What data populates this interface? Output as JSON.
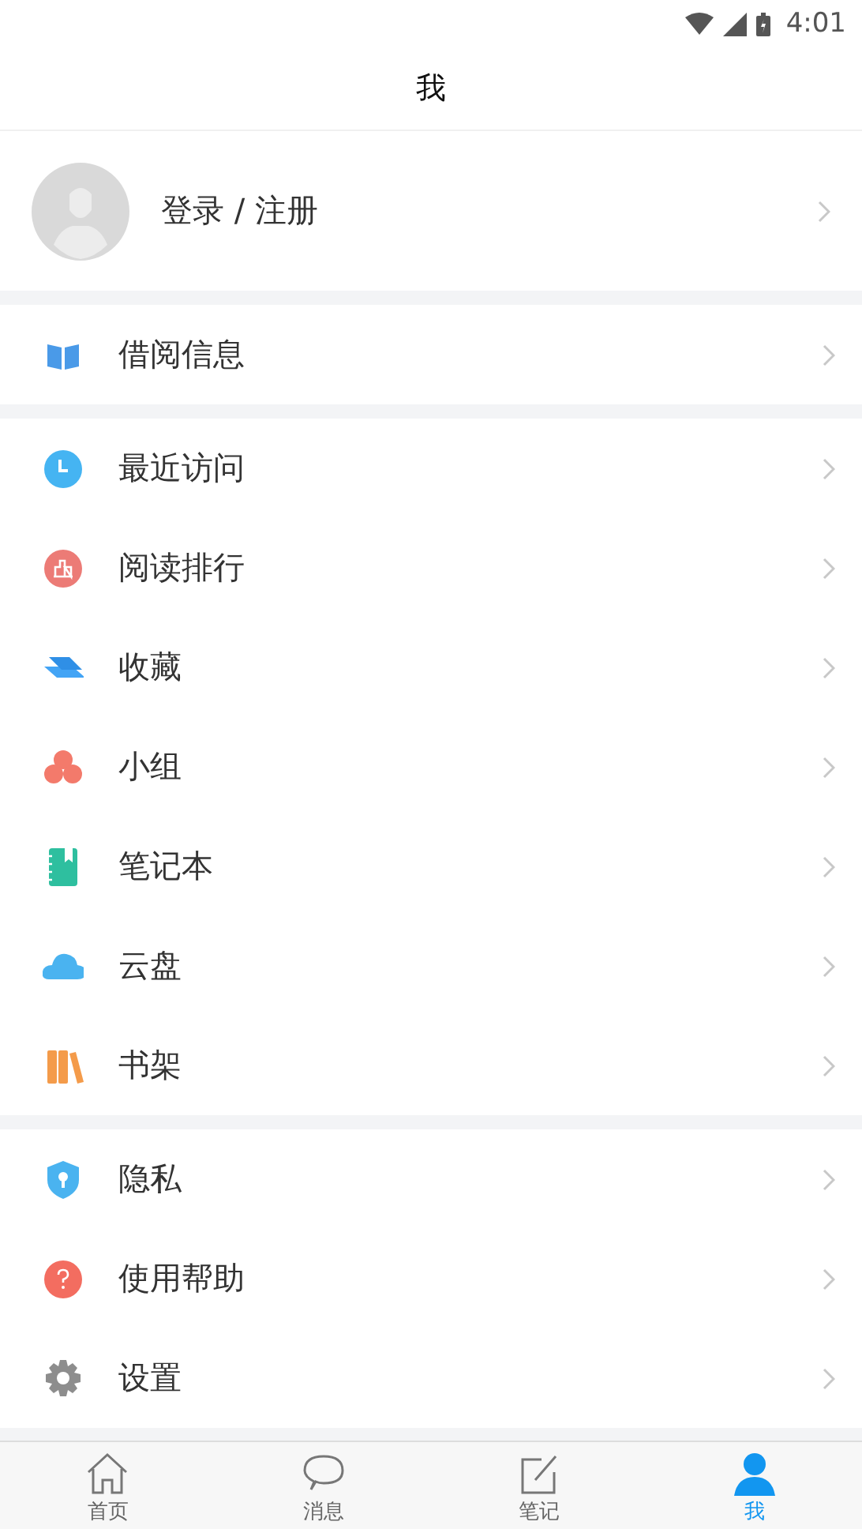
{
  "status_bar": {
    "time": "4:01"
  },
  "header": {
    "title": "我"
  },
  "profile": {
    "label": "登录 / 注册"
  },
  "menu_groups": [
    {
      "items": [
        {
          "label": "借阅信息"
        }
      ]
    },
    {
      "items": [
        {
          "label": "最近访问"
        },
        {
          "label": "阅读排行"
        },
        {
          "label": "收藏"
        },
        {
          "label": "小组"
        },
        {
          "label": "笔记本"
        },
        {
          "label": "云盘"
        },
        {
          "label": "书架"
        }
      ]
    },
    {
      "items": [
        {
          "label": "隐私"
        },
        {
          "label": "使用帮助"
        },
        {
          "label": "设置"
        }
      ]
    }
  ],
  "tab_bar": [
    {
      "label": "首页",
      "selected": false
    },
    {
      "label": "消息",
      "selected": false
    },
    {
      "label": "笔记",
      "selected": false
    },
    {
      "label": "我",
      "selected": true
    }
  ]
}
